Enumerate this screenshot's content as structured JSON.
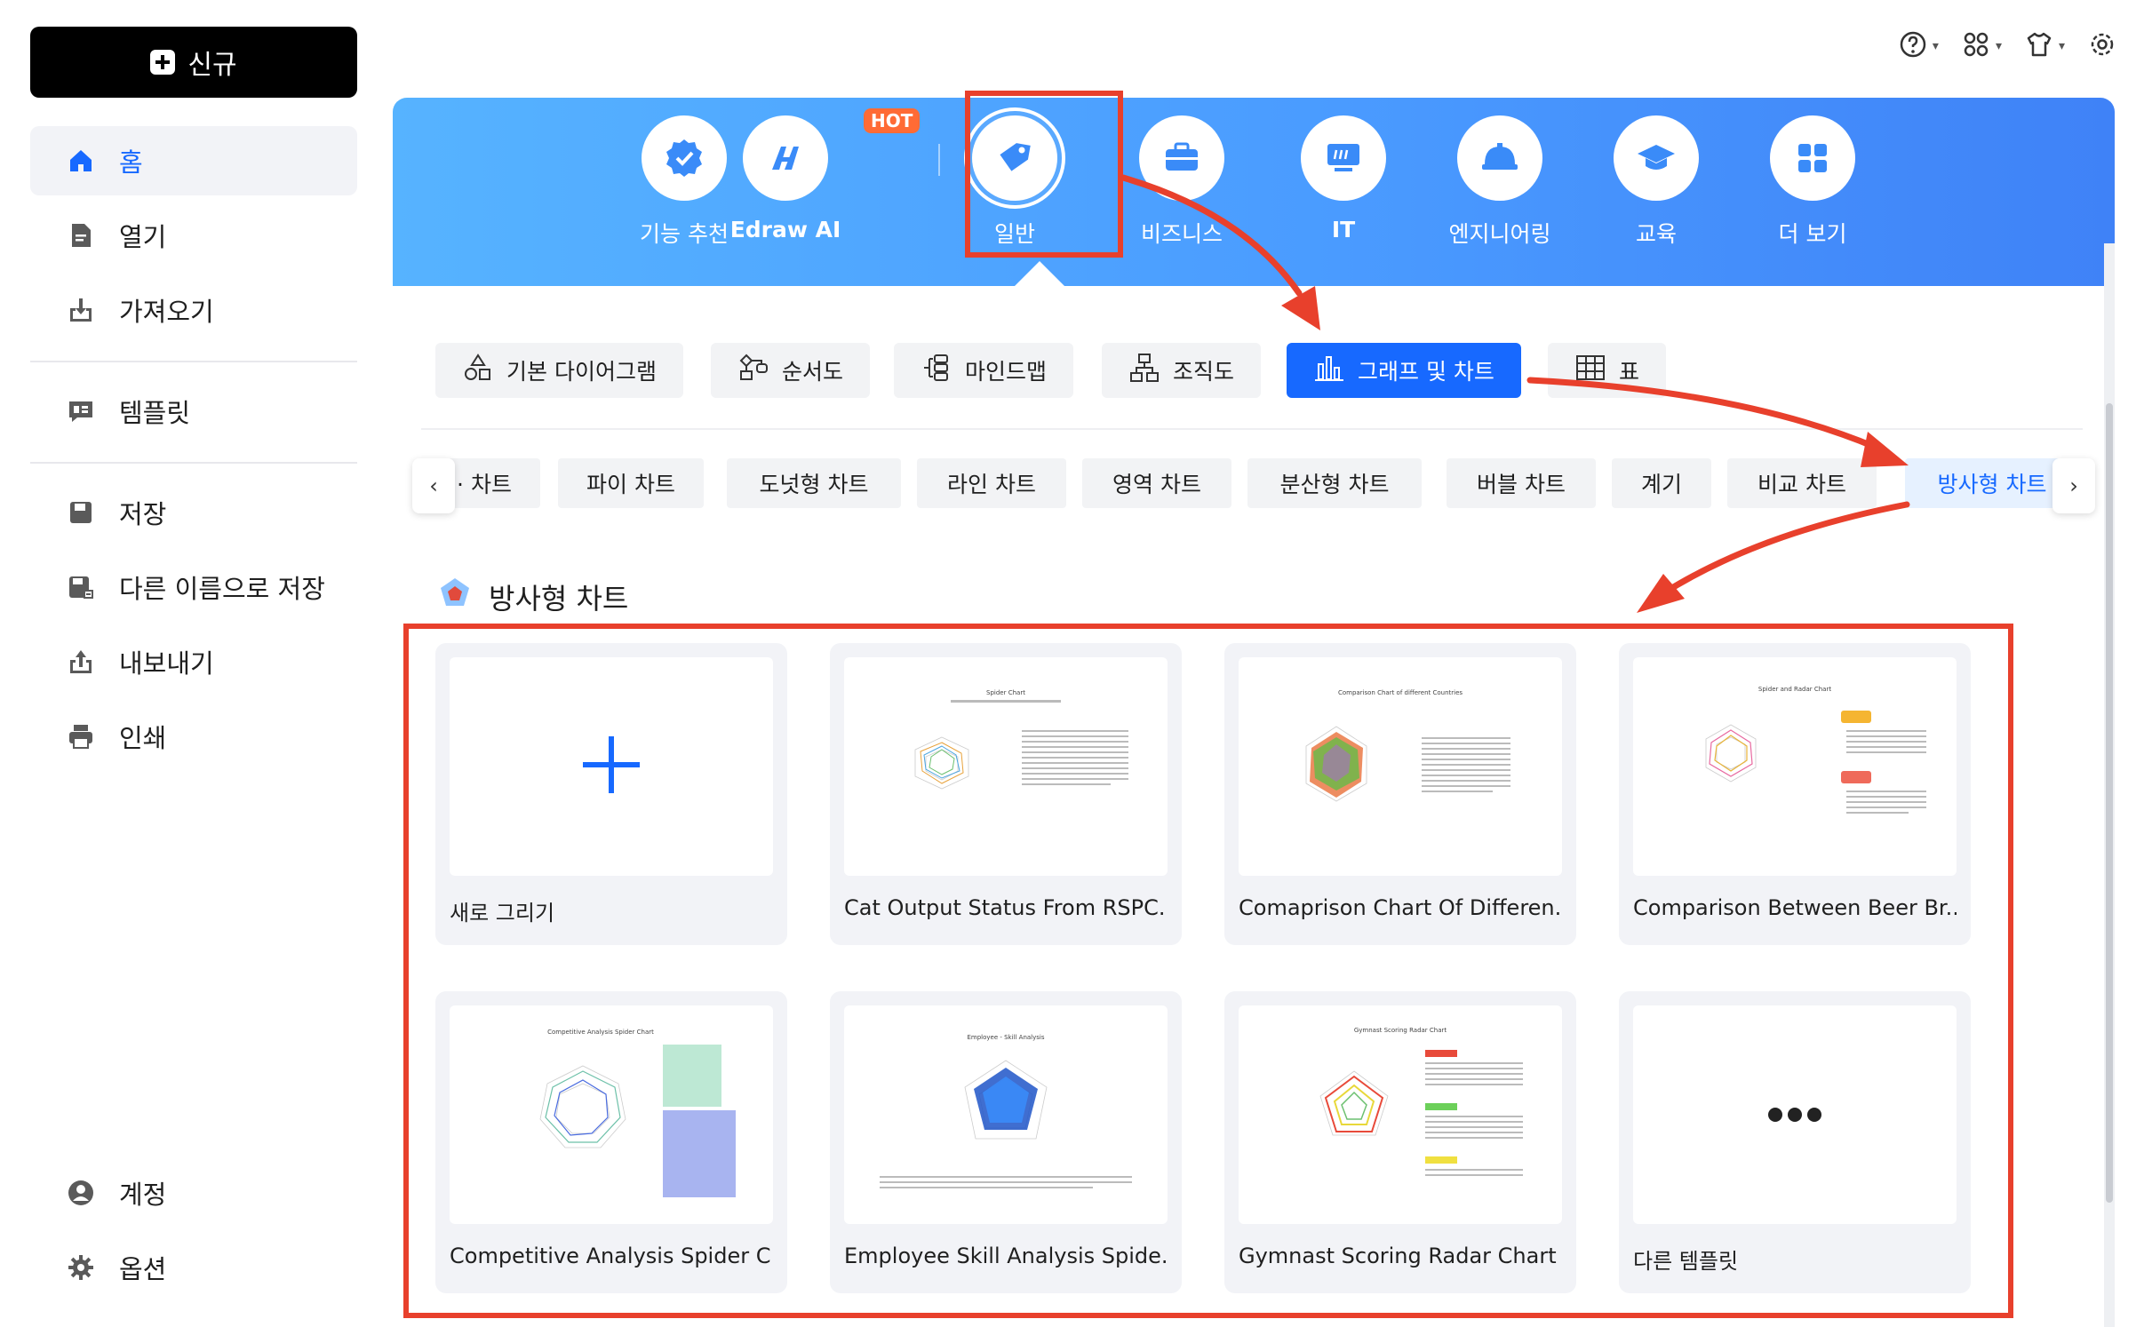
{
  "sidebar": {
    "new_button": "신규",
    "items": [
      {
        "label": "홈",
        "icon": "home-icon"
      },
      {
        "label": "열기",
        "icon": "file-icon"
      },
      {
        "label": "가져오기",
        "icon": "import-icon"
      },
      {
        "label": "템플릿",
        "icon": "template-icon"
      },
      {
        "label": "저장",
        "icon": "save-icon"
      },
      {
        "label": "다른 이름으로 저장",
        "icon": "save-as-icon"
      },
      {
        "label": "내보내기",
        "icon": "export-icon"
      },
      {
        "label": "인쇄",
        "icon": "print-icon"
      },
      {
        "label": "계정",
        "icon": "account-icon"
      },
      {
        "label": "옵션",
        "icon": "gear-icon"
      }
    ]
  },
  "header_icons": [
    "help-icon",
    "apps-icon",
    "theme-icon",
    "settings-icon"
  ],
  "categories": [
    {
      "label": "기능 추천",
      "icon": "badge-icon"
    },
    {
      "label": "Edraw AI",
      "icon": "ai-icon",
      "badge": "HOT"
    },
    {
      "label": "일반",
      "icon": "tag-icon",
      "selected": true
    },
    {
      "label": "비즈니스",
      "icon": "briefcase-icon"
    },
    {
      "label": "IT",
      "icon": "monitor-icon"
    },
    {
      "label": "엔지니어링",
      "icon": "helmet-icon"
    },
    {
      "label": "교육",
      "icon": "graduation-cap-icon"
    },
    {
      "label": "더 보기",
      "icon": "grid-icon"
    }
  ],
  "subtabs": [
    {
      "label": "기본 다이어그램"
    },
    {
      "label": "순서도"
    },
    {
      "label": "마인드맵"
    },
    {
      "label": "조직도"
    },
    {
      "label": "그래프 및 차트",
      "active": true
    },
    {
      "label": "표"
    }
  ],
  "chart_types": [
    {
      "label": "· 차트"
    },
    {
      "label": "파이 차트"
    },
    {
      "label": "도넛형 차트"
    },
    {
      "label": "라인 차트"
    },
    {
      "label": "영역 차트"
    },
    {
      "label": "분산형 차트"
    },
    {
      "label": "버블 차트"
    },
    {
      "label": "계기"
    },
    {
      "label": "비교 차트"
    },
    {
      "label": "방사형 차트",
      "active": true
    }
  ],
  "section_title": "방사형 차트",
  "cards": [
    {
      "title": "새로 그리기"
    },
    {
      "title": "Cat Output Status From RSPC...",
      "thumb_title": "Spider Chart"
    },
    {
      "title": "Comaprison Chart Of Differen...",
      "thumb_title": "Comparison Chart of different Countries"
    },
    {
      "title": "Comparison Between Beer Br...",
      "thumb_title": "Spider and Radar Chart"
    },
    {
      "title": "Competitive Analysis Spider C...",
      "thumb_title": "Competitive Analysis Spider Chart"
    },
    {
      "title": "Employee Skill Analysis Spide...",
      "thumb_title": "Employee - Skill Analysis"
    },
    {
      "title": "Gymnast Scoring Radar Chart ...",
      "thumb_title": "Gymnast Scoring Radar Chart"
    },
    {
      "title": "다른 템플릿"
    }
  ],
  "colors": {
    "accent": "#1769ff",
    "annotation_red": "#e8402c",
    "banner_start": "#56b3ff",
    "banner_end": "#3f82f7"
  }
}
